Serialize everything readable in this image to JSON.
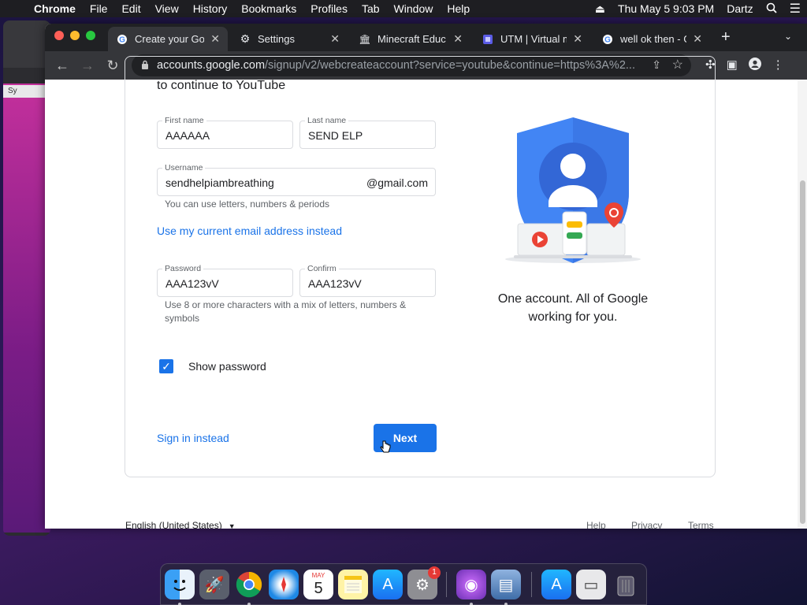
{
  "menubar": {
    "app": "Chrome",
    "items": [
      "File",
      "Edit",
      "View",
      "History",
      "Bookmarks",
      "Profiles",
      "Tab",
      "Window",
      "Help"
    ],
    "datetime": "Thu May 5  9:03 PM",
    "user": "Dartz"
  },
  "background_window": {
    "label": "Sy"
  },
  "tabs": [
    {
      "title": "Create your Go",
      "icon": "google-icon"
    },
    {
      "title": "Settings",
      "icon": "gear-icon"
    },
    {
      "title": "Minecraft Educ",
      "icon": "museum-icon"
    },
    {
      "title": "UTM | Virtual m",
      "icon": "utm-icon"
    },
    {
      "title": "well ok then - G",
      "icon": "google-icon"
    }
  ],
  "address_bar": {
    "host": "accounts.google.com",
    "path": "/signup/v2/webcreateaccount?service=youtube&continue=https%3A%2..."
  },
  "form": {
    "subtitle": "to continue to YouTube",
    "first_name": {
      "label": "First name",
      "value": "AAAAAA"
    },
    "last_name": {
      "label": "Last name",
      "value": "SEND ELP"
    },
    "username": {
      "label": "Username",
      "value": "sendhelpiambreathing",
      "suffix": "@gmail.com"
    },
    "username_hint": "You can use letters, numbers & periods",
    "use_current_email": "Use my current email address instead",
    "password": {
      "label": "Password",
      "value": "AAA123vV"
    },
    "confirm": {
      "label": "Confirm",
      "value": "AAA123vV"
    },
    "password_hint": "Use 8 or more characters with a mix of letters, numbers & symbols",
    "show_password": {
      "label": "Show password",
      "checked": true
    },
    "sign_in_instead": "Sign in instead",
    "next": "Next"
  },
  "side": {
    "tagline_line1": "One account. All of Google",
    "tagline_line2": "working for you."
  },
  "footer": {
    "language": "English (United States)",
    "links": [
      "Help",
      "Privacy",
      "Terms"
    ]
  },
  "dock": {
    "calendar_month": "MAY",
    "calendar_day": "5",
    "settings_badge": "1"
  },
  "colors": {
    "accent": "#1a73e8",
    "menubar": "#1e1e22",
    "tabstrip": "#202124",
    "toolbar": "#35363a"
  }
}
